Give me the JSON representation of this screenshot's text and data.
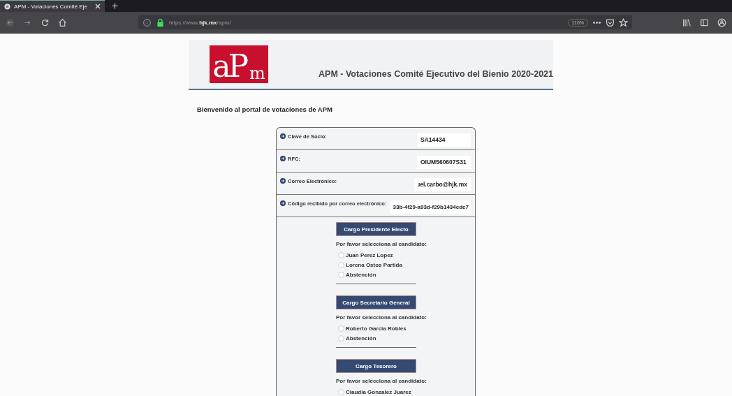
{
  "browser": {
    "tab": {
      "title": "APM - Votaciones Comité Eje",
      "selected": true
    },
    "url_prefix": "https://www.",
    "url_domain": "hjk.mx",
    "url_path": "/apm/",
    "zoom": "110%"
  },
  "header": {
    "logo_letters": [
      "a",
      "P",
      "m"
    ],
    "title": "APM - Votaciones Comité Ejecutivo del Bienio 2020-2021"
  },
  "welcome": "Bienvenido al portal de votaciones de APM",
  "fields": [
    {
      "label": "Clave de Socio:",
      "value": "SA14434"
    },
    {
      "label": "RFC:",
      "value": "OIUM560607S31"
    },
    {
      "label": "Correo Electrónico:",
      "value": "ɹel.carbo@hjk.mx"
    },
    {
      "label": "Código recibido por correo electrónico:",
      "value": "33b-4f29-a93d-f29b1434cdc7"
    }
  ],
  "sections": [
    {
      "title": "Cargo Presidente Electo",
      "prompt": "Por favor selecciona al candidato:",
      "options": [
        {
          "label": "Juan Perez Lopez",
          "selected": false
        },
        {
          "label": "Lorena Ostos Partida",
          "selected": false
        },
        {
          "label": "Abstención",
          "selected": false
        }
      ]
    },
    {
      "title": "Cargo Secretario General",
      "prompt": "Por favor selecciona al candidato:",
      "options": [
        {
          "label": "Roberto Garcia Robles",
          "selected": false
        },
        {
          "label": "Abstención",
          "selected": false
        }
      ]
    },
    {
      "title": "Cargo Tesorero",
      "prompt": "Por favor selecciona al candidato:",
      "options": [
        {
          "label": "Claudia Gonzalez Juarez",
          "selected": false
        }
      ]
    }
  ]
}
